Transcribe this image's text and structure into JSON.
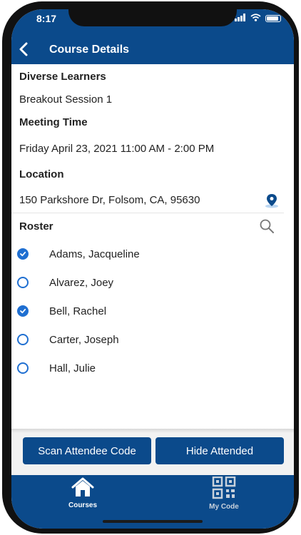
{
  "status": {
    "time": "8:17"
  },
  "header": {
    "title": "Course Details"
  },
  "course": {
    "name": "Diverse Learners",
    "session": "Breakout Session 1",
    "meeting_time_label": "Meeting Time",
    "meeting_time": "Friday April 23, 2021 11:00 AM - 2:00 PM",
    "location_label": "Location",
    "location": "150 Parkshore Dr, Folsom, CA, 95630"
  },
  "roster": {
    "label": "Roster",
    "items": [
      {
        "name": "Adams, Jacqueline",
        "checked": true
      },
      {
        "name": "Alvarez, Joey",
        "checked": false
      },
      {
        "name": "Bell, Rachel",
        "checked": true
      },
      {
        "name": "Carter, Joseph",
        "checked": false
      },
      {
        "name": "Hall, Julie",
        "checked": false
      }
    ]
  },
  "actions": {
    "scan_label": "Scan Attendee Code",
    "hide_label": "Hide Attended"
  },
  "tabs": [
    {
      "label": "Courses",
      "icon": "home-icon",
      "active": true
    },
    {
      "label": "My Code",
      "icon": "qr-code-icon",
      "active": false
    }
  ],
  "colors": {
    "brand": "#0b4a8b",
    "accent": "#1f6fd1"
  }
}
